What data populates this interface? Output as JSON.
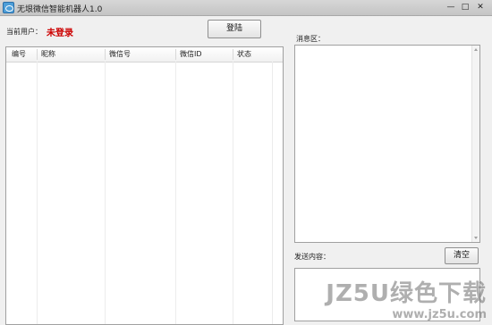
{
  "window": {
    "title": "无垠微信智能机器人1.0",
    "controls": {
      "minimize": "—",
      "maximize": "□",
      "close": "✕"
    }
  },
  "user": {
    "label": "当前用户：",
    "status": "未登录"
  },
  "buttons": {
    "login": "登陆",
    "clear": "清空"
  },
  "contacts_table": {
    "columns": [
      "编号",
      "昵称",
      "微信号",
      "微信ID",
      "状态"
    ],
    "rows": []
  },
  "message_area": {
    "label": "消息区：",
    "content": ""
  },
  "send_area": {
    "label": "发送内容：",
    "content": ""
  },
  "watermark": {
    "main": "JZ5U绿色下载",
    "url": "www.jz5u.com"
  },
  "colors": {
    "status_red": "#cc0000",
    "window_bg": "#f0f0f0"
  }
}
